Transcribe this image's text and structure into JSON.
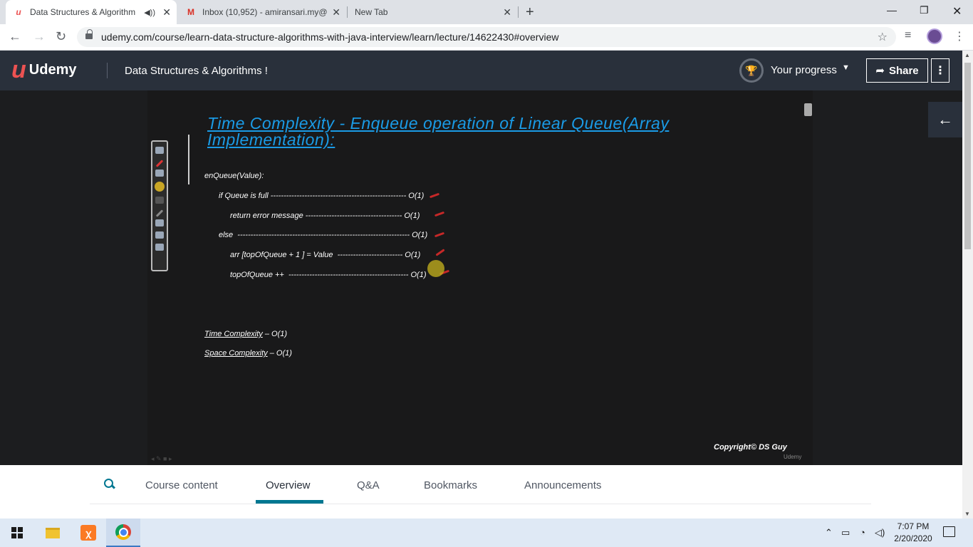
{
  "browser": {
    "tabs": [
      {
        "title": "Data Structures & Algorithm",
        "favicon": "udemy-icon",
        "active": true
      },
      {
        "title": "Inbox (10,952) - amiransari.my@",
        "favicon": "gmail-icon",
        "active": false
      },
      {
        "title": "New Tab",
        "favicon": "",
        "active": false
      }
    ],
    "url": "udemy.com/course/learn-data-structure-algorithms-with-java-interview/learn/lecture/14622430#overview"
  },
  "header": {
    "logo_text": "Udemy",
    "course_title": "Data Structures & Algorithms !",
    "progress_label": "Your progress",
    "share_label": "Share"
  },
  "slide": {
    "title": "Time Complexity - Enqueue operation of Linear Queue(Array Implementation):",
    "lines": [
      "enQueue(Value):",
      "if Queue is full ---------------------------------------------------- O(1)",
      "return error message ------------------------------------- O(1)",
      "else  ------------------------------------------------------------------ O(1)",
      "arr [topOfQueue + 1 ] = Value  ------------------------- O(1)",
      "topOfQueue ++  ---------------------------------------------- O(1)"
    ],
    "time_label": "Time Complexity",
    "time_value": " – O(1)",
    "space_label": "Space Complexity",
    "space_value": " – O(1)",
    "copyright": "Copyright© DS Guy",
    "watermark": "Udemy"
  },
  "course_tabs": [
    "Course content",
    "Overview",
    "Q&A",
    "Bookmarks",
    "Announcements"
  ],
  "taskbar": {
    "time": "7:07 PM",
    "date": "2/20/2020"
  }
}
